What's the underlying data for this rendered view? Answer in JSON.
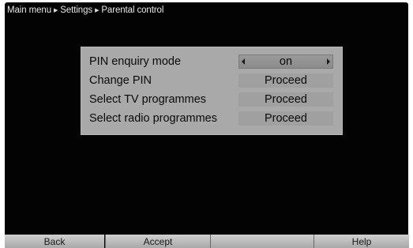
{
  "breadcrumb": {
    "items": [
      "Main menu",
      "Settings",
      "Parental control"
    ],
    "separator_icon": "triangle-right-icon"
  },
  "menu": {
    "rows": [
      {
        "label": "PIN enquiry mode",
        "value": "on",
        "type": "selector"
      },
      {
        "label": "Change PIN",
        "value": "Proceed",
        "type": "button"
      },
      {
        "label": "Select TV programmes",
        "value": "Proceed",
        "type": "button"
      },
      {
        "label": "Select radio programmes",
        "value": "Proceed",
        "type": "button"
      }
    ]
  },
  "footer": {
    "back": "Back",
    "accept": "Accept",
    "empty": "",
    "help": "Help"
  },
  "colors": {
    "screen_bg": "#030303",
    "panel_bg": "#a9a9a9",
    "footer_bg": "#bdbdbd"
  }
}
